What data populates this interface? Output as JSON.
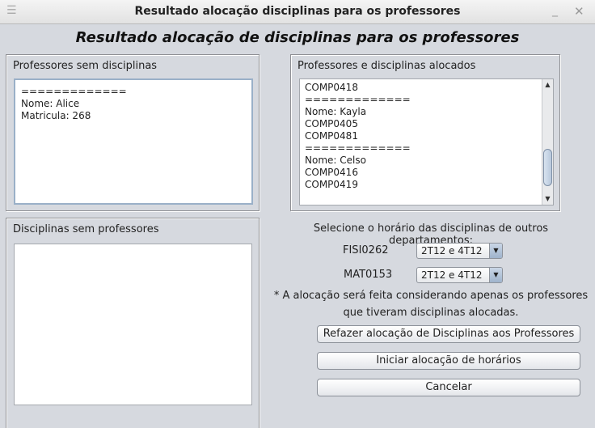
{
  "window": {
    "title": "Resultado alocação disciplinas para os professores",
    "menu_icon": "hamburger-menu-icon",
    "minimize_glyph": "_",
    "close_glyph": "✕"
  },
  "heading": "Resultado alocação de disciplinas para os professores",
  "panels": {
    "unassigned_professors": {
      "title": "Professores sem disciplinas",
      "text": "=============\nNome: Alice\nMatricula: 268"
    },
    "assigned": {
      "title": "Professores e disciplinas alocados",
      "text": "COMP0418\n=============\nNome: Kayla\nCOMP0405\nCOMP0481\n=============\nNome: Celso\nCOMP0416\nCOMP0419"
    },
    "unassigned_courses": {
      "title": "Disciplinas sem professores",
      "text": ""
    }
  },
  "schedule": {
    "prompt": "Selecione o horário das disciplinas de outros departamentos:",
    "selects": [
      {
        "label": "FISI0262",
        "value": "2T12 e 4T12"
      },
      {
        "label": "MAT0153",
        "value": "2T12 e 4T12"
      }
    ],
    "note_line1": "* A alocação será feita considerando apenas os professores",
    "note_line2": "que tiveram disciplinas alocadas."
  },
  "buttons": {
    "redo": "Refazer alocação de Disciplinas aos Professores",
    "start": "Iniciar alocação de horários",
    "cancel": "Cancelar"
  },
  "glyphs": {
    "scroll_up": "▲",
    "scroll_down": "▼",
    "combo_arrow": "▼"
  }
}
